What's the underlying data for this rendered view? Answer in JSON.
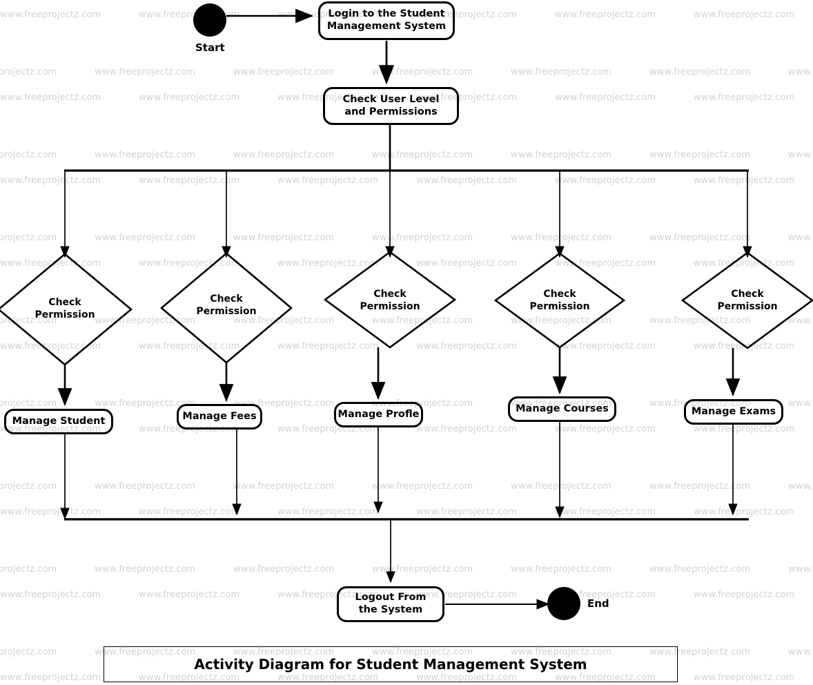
{
  "diagram": {
    "title": "Activity Diagram for Student Management System",
    "watermark_text": "www.freeprojectz.com",
    "colors": {
      "stroke": "#000000",
      "background": "#ffffff",
      "watermark": "#d2d2d2"
    },
    "start_label": "Start",
    "end_label": "End",
    "nodes": {
      "login": "Login to the Student Management System",
      "check_user": "Check User Level and Permissions",
      "logout": "Logout From the System"
    },
    "decisions": [
      {
        "id": "d1",
        "label_line1": "Check",
        "label_line2": "Permission"
      },
      {
        "id": "d2",
        "label_line1": "Check",
        "label_line2": "Permission"
      },
      {
        "id": "d3",
        "label_line1": "Check",
        "label_line2": "Permission"
      },
      {
        "id": "d4",
        "label_line1": "Check",
        "label_line2": "Permission"
      },
      {
        "id": "d5",
        "label_line1": "Check",
        "label_line2": "Permission"
      }
    ],
    "activities": [
      {
        "id": "a1",
        "label": "Manage Student"
      },
      {
        "id": "a2",
        "label": "Manage Fees"
      },
      {
        "id": "a3",
        "label": "Manage Profle"
      },
      {
        "id": "a4",
        "label": "Manage Courses"
      },
      {
        "id": "a5",
        "label": "Manage Exams"
      }
    ]
  }
}
